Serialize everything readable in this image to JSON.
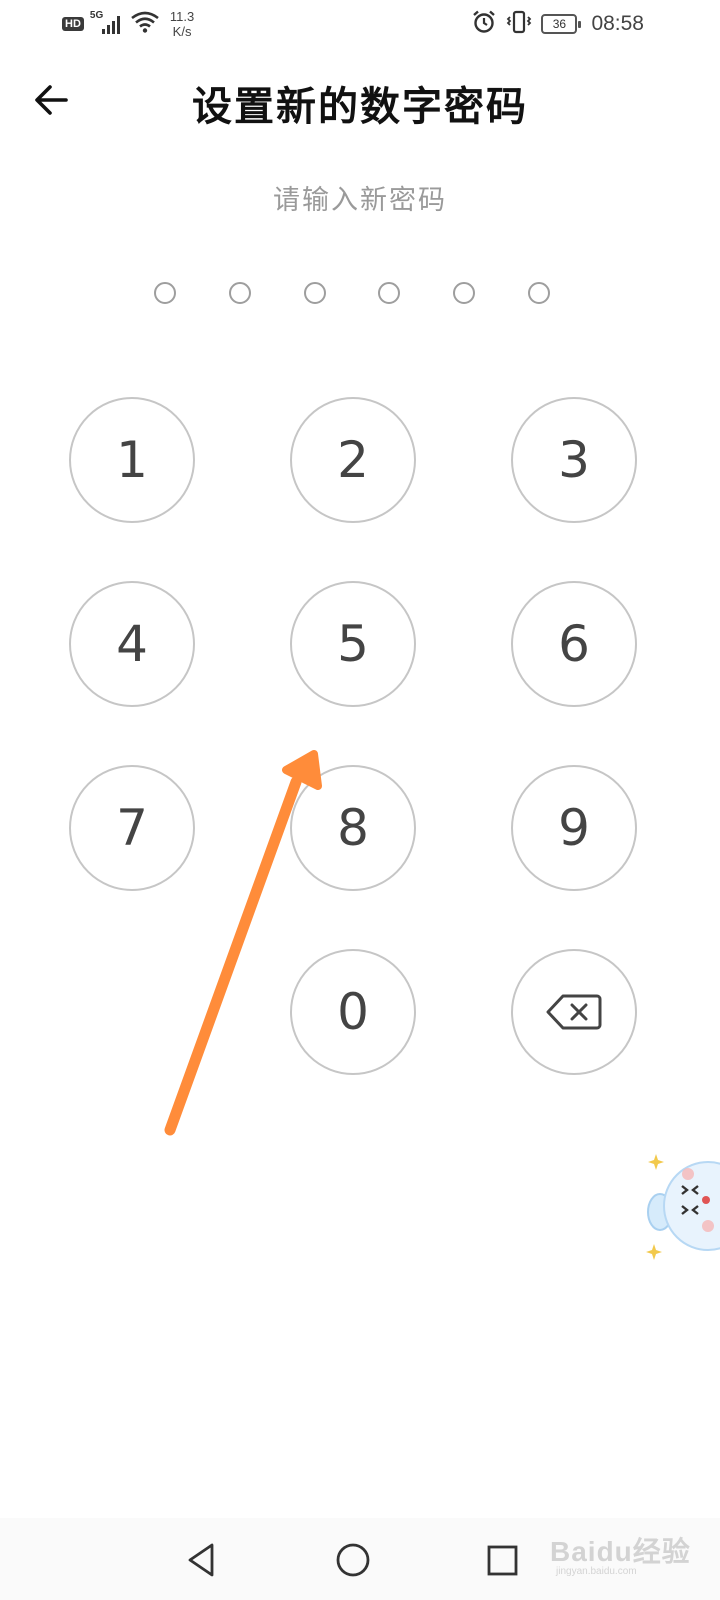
{
  "status_bar": {
    "hd": "HD",
    "network": "5G",
    "speed_value": "11.3",
    "speed_unit": "K/s",
    "battery": "36",
    "time": "08:58"
  },
  "header": {
    "title": "设置新的数字密码",
    "back_icon": "back-arrow-icon"
  },
  "prompt": "请输入新密码",
  "pin": {
    "length": 6,
    "entered": 0
  },
  "keypad": {
    "keys": [
      "1",
      "2",
      "3",
      "4",
      "5",
      "6",
      "7",
      "8",
      "9",
      "0"
    ],
    "delete_icon": "backspace-icon"
  },
  "navbar": {
    "icons": [
      "back-triangle-icon",
      "home-circle-icon",
      "recents-square-icon"
    ]
  },
  "watermark": {
    "brand": "Baidu经验",
    "site": "jingyan.baidu.com"
  },
  "colors": {
    "annotation_arrow": "#FF8C3A",
    "key_border": "#C6C6C6",
    "prompt_text": "#9A9A9A"
  }
}
